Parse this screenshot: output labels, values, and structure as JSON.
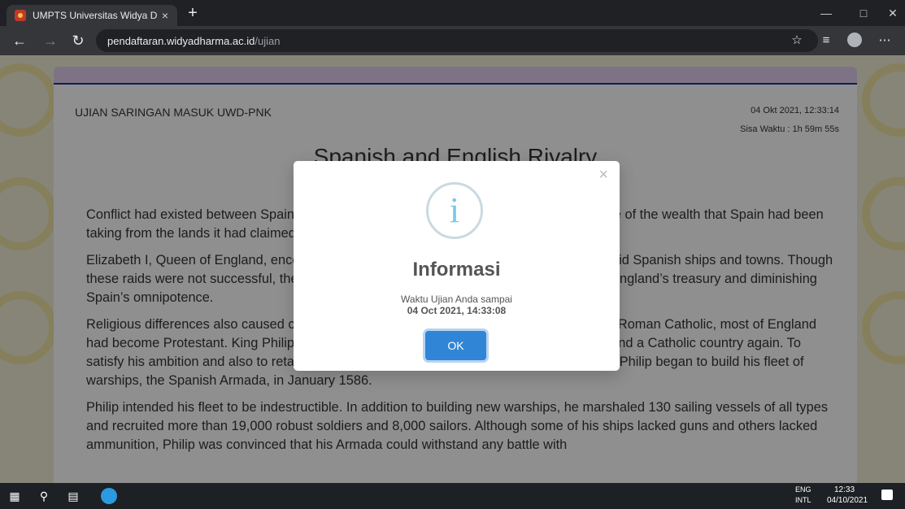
{
  "browser": {
    "tab_title": "UMPTS Universitas Widya Dharma",
    "tab_close": "×",
    "new_tab": "+",
    "url_domain": "pendaftaran.widyadharma.ac.id",
    "url_path": "/ujian",
    "icons": [
      "back-icon",
      "forward-icon",
      "reload-icon",
      "add-favorite-icon",
      "favorites-icon",
      "profile-icon",
      "more-icon"
    ]
  },
  "header": {
    "exam_title": "UJIAN SARINGAN MASUK UWD-PNK",
    "datetime": "04 Okt 2021, 12:33:14",
    "remaining": "Sisa Waktu : 1h 59m 55s"
  },
  "passage": {
    "title": "Spanish and English Rivalry",
    "paragraphs": [
      "Conflict had existed between Spain and England since the 1570s. England wanted a share of the wealth that Spain had been taking from the lands it had claimed in the Americas.",
      "Elizabeth I, Queen of England, encouraged her admirals, including Sir Francis Drake, to raid Spanish ships and towns. Though these raids were not successful, they were a dramatic success, adding gold and silver to England’s treasury and diminishing Spain’s omnipotence.",
      "Religious differences also caused conflict between the two countries. Whereas Spain was Roman Catholic, most of England had become Protestant. King Philip II of Spain wanted to claim the throne and make England a Catholic country again. To satisfy his ambition and also to retaliate against England’s theft of his gold and silver, King Philip began to build his fleet of warships, the Spanish Armada, in January 1586.",
      "Philip intended his fleet to be indestructible. In addition to building new warships, he marshaled 130 sailing vessels of all types and recruited more than 19,000 robust soldiers and 8,000 sailors. Although some of his ships lacked guns and others lacked ammunition, Philip was convinced that his Armada could withstand any battle with"
    ]
  },
  "modal": {
    "title": "Informasi",
    "message": "Waktu Ujian Anda sampai",
    "deadline": "04 Oct 2021, 14:33:08",
    "ok_label": "OK",
    "close_symbol": "×",
    "info_symbol": "i"
  },
  "taskbar": {
    "lang1": "ENG",
    "lang2": "INTL",
    "time": "12:33",
    "date": "04/10/2021"
  }
}
